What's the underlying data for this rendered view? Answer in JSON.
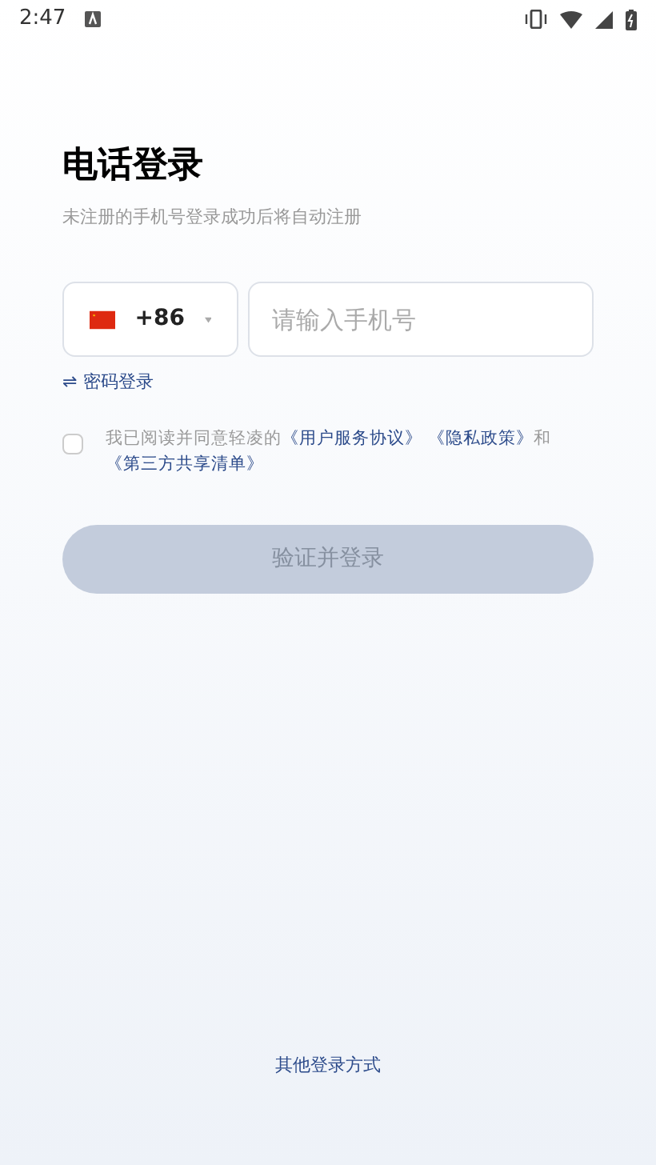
{
  "status_bar": {
    "time": "2:47"
  },
  "title": "电话登录",
  "subtitle": "未注册的手机号登录成功后将自动注册",
  "phone": {
    "country_code": "+86",
    "placeholder": "请输入手机号"
  },
  "switch_link": {
    "icon": "⇌",
    "label": "密码登录"
  },
  "agreement": {
    "checked": false,
    "text": "我已阅读并同意轻凌的",
    "links": [
      "《用户服务协议》",
      "《隐私政策》",
      "《第三方共享清单》"
    ],
    "joiner": "和"
  },
  "login_button": {
    "label": "验证并登录",
    "disabled": true
  },
  "other_login": "其他登录方式"
}
